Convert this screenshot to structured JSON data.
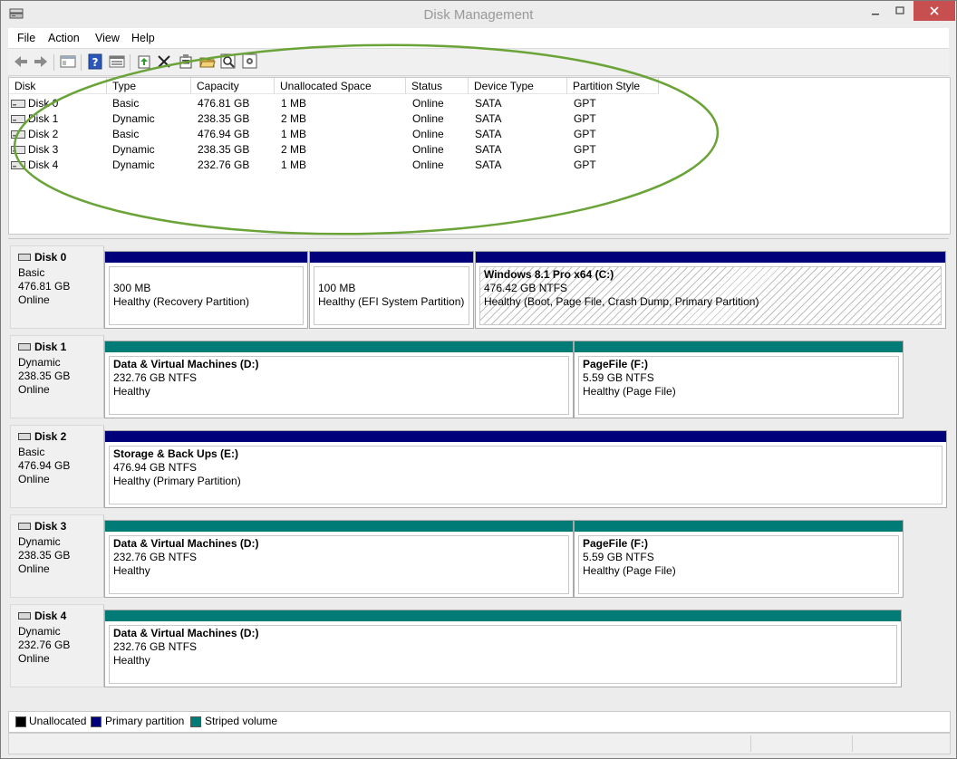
{
  "window": {
    "title": "Disk Management"
  },
  "menu": [
    "File",
    "Action",
    "View",
    "Help"
  ],
  "toolbar_icons": [
    "back-icon",
    "forward-icon",
    "console-tree-icon",
    "help-icon",
    "properties-view-icon",
    "refresh-icon",
    "delete-icon",
    "properties-icon",
    "open-icon",
    "search-icon",
    "settings-icon"
  ],
  "disk_list": {
    "columns": [
      "Disk",
      "Type",
      "Capacity",
      "Unallocated Space",
      "Status",
      "Device Type",
      "Partition Style"
    ],
    "rows": [
      [
        "Disk 0",
        "Basic",
        "476.81 GB",
        "1 MB",
        "Online",
        "SATA",
        "GPT"
      ],
      [
        "Disk 1",
        "Dynamic",
        "238.35 GB",
        "2 MB",
        "Online",
        "SATA",
        "GPT"
      ],
      [
        "Disk 2",
        "Basic",
        "476.94 GB",
        "1 MB",
        "Online",
        "SATA",
        "GPT"
      ],
      [
        "Disk 3",
        "Dynamic",
        "238.35 GB",
        "2 MB",
        "Online",
        "SATA",
        "GPT"
      ],
      [
        "Disk 4",
        "Dynamic",
        "232.76 GB",
        "1 MB",
        "Online",
        "SATA",
        "GPT"
      ]
    ]
  },
  "disks": [
    {
      "name": "Disk 0",
      "type": "Basic",
      "size": "476.81 GB",
      "status": "Online",
      "partitions": [
        {
          "name": "",
          "size": "300 MB",
          "health": "Healthy (Recovery Partition)"
        },
        {
          "name": "",
          "size": "100 MB",
          "health": "Healthy (EFI System Partition)"
        },
        {
          "name": "Windows 8.1 Pro x64  (C:)",
          "size": "476.42 GB NTFS",
          "health": "Healthy (Boot, Page File, Crash Dump, Primary Partition)"
        }
      ]
    },
    {
      "name": "Disk 1",
      "type": "Dynamic",
      "size": "238.35 GB",
      "status": "Online",
      "partitions": [
        {
          "name": "Data & Virtual Machines  (D:)",
          "size": "232.76 GB NTFS",
          "health": "Healthy"
        },
        {
          "name": "PageFile  (F:)",
          "size": "5.59 GB NTFS",
          "health": "Healthy (Page File)"
        }
      ]
    },
    {
      "name": "Disk 2",
      "type": "Basic",
      "size": "476.94 GB",
      "status": "Online",
      "partitions": [
        {
          "name": "Storage & Back Ups  (E:)",
          "size": "476.94 GB NTFS",
          "health": "Healthy (Primary Partition)"
        }
      ]
    },
    {
      "name": "Disk 3",
      "type": "Dynamic",
      "size": "238.35 GB",
      "status": "Online",
      "partitions": [
        {
          "name": "Data & Virtual Machines  (D:)",
          "size": "232.76 GB NTFS",
          "health": "Healthy"
        },
        {
          "name": "PageFile  (F:)",
          "size": "5.59 GB NTFS",
          "health": "Healthy (Page File)"
        }
      ]
    },
    {
      "name": "Disk 4",
      "type": "Dynamic",
      "size": "232.76 GB",
      "status": "Online",
      "partitions": [
        {
          "name": "Data & Virtual Machines  (D:)",
          "size": "232.76 GB NTFS",
          "health": "Healthy"
        }
      ]
    }
  ],
  "legend": [
    {
      "label": "Unallocated",
      "color": "#000000"
    },
    {
      "label": "Primary partition",
      "color": "#00007a"
    },
    {
      "label": "Striped volume",
      "color": "#007b76"
    }
  ],
  "colors": {
    "primary": "#00007a",
    "striped": "#007b76",
    "highlight_oval": "#6aa338",
    "close_button": "#c74f4f"
  }
}
